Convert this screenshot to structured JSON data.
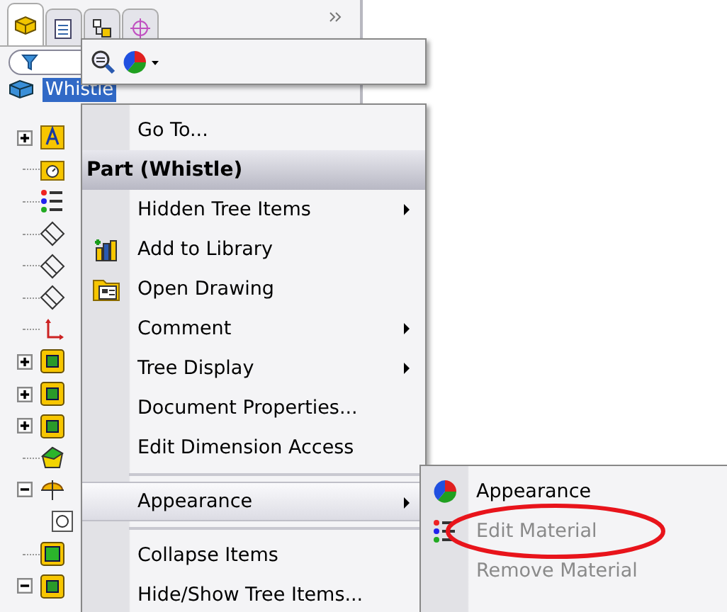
{
  "panel_tabs": [
    {
      "selected": true
    },
    {
      "selected": false
    },
    {
      "selected": false
    },
    {
      "selected": false
    }
  ],
  "tree": {
    "label": "Whistle",
    "selected": true,
    "children": [
      {
        "kind": "annotations",
        "expandable": true,
        "expanded": false
      },
      {
        "kind": "sensors",
        "expandable": false
      },
      {
        "kind": "material",
        "expandable": false
      },
      {
        "kind": "plane",
        "expandable": false
      },
      {
        "kind": "plane",
        "expandable": false
      },
      {
        "kind": "plane",
        "expandable": false
      },
      {
        "kind": "origin",
        "expandable": false
      },
      {
        "kind": "feature",
        "expandable": true,
        "expanded": false
      },
      {
        "kind": "feature",
        "expandable": true,
        "expanded": false
      },
      {
        "kind": "feature",
        "expandable": true,
        "expanded": false
      },
      {
        "kind": "surface",
        "expandable": false
      },
      {
        "kind": "mate",
        "expandable": true,
        "expanded": true,
        "children": [
          {
            "kind": "sketch"
          }
        ]
      },
      {
        "kind": "solid",
        "expandable": false
      },
      {
        "kind": "feature",
        "expandable": true,
        "expanded": true
      }
    ]
  },
  "context_menu": {
    "items": [
      {
        "kind": "item",
        "label": "Go To...",
        "submenu": false,
        "selected": false
      },
      {
        "kind": "header",
        "label": "Part (Whistle)"
      },
      {
        "kind": "item",
        "label": "Hidden Tree Items",
        "submenu": true,
        "selected": false
      },
      {
        "kind": "item",
        "label": "Add to Library",
        "submenu": false,
        "selected": false
      },
      {
        "kind": "item",
        "label": "Open Drawing",
        "submenu": false,
        "selected": false
      },
      {
        "kind": "item",
        "label": "Comment",
        "submenu": true,
        "selected": false
      },
      {
        "kind": "item",
        "label": "Tree Display",
        "submenu": true,
        "selected": false
      },
      {
        "kind": "item",
        "label": "Document Properties...",
        "submenu": false,
        "selected": false
      },
      {
        "kind": "item",
        "label": "Edit Dimension Access",
        "submenu": false,
        "selected": false
      },
      {
        "kind": "separator"
      },
      {
        "kind": "item",
        "label": "Appearance",
        "submenu": true,
        "selected": true
      },
      {
        "kind": "separator"
      },
      {
        "kind": "item",
        "label": "Collapse Items",
        "submenu": false,
        "selected": false
      },
      {
        "kind": "item",
        "label": "Hide/Show Tree Items...",
        "submenu": false,
        "selected": false
      }
    ]
  },
  "submenu": {
    "items": [
      {
        "label": "Appearance",
        "disabled": false
      },
      {
        "label": "Edit Material",
        "disabled": true
      },
      {
        "label": "Remove Material",
        "disabled": true
      }
    ]
  },
  "annotation": {
    "kind": "ellipse",
    "color": "#e8141b"
  }
}
